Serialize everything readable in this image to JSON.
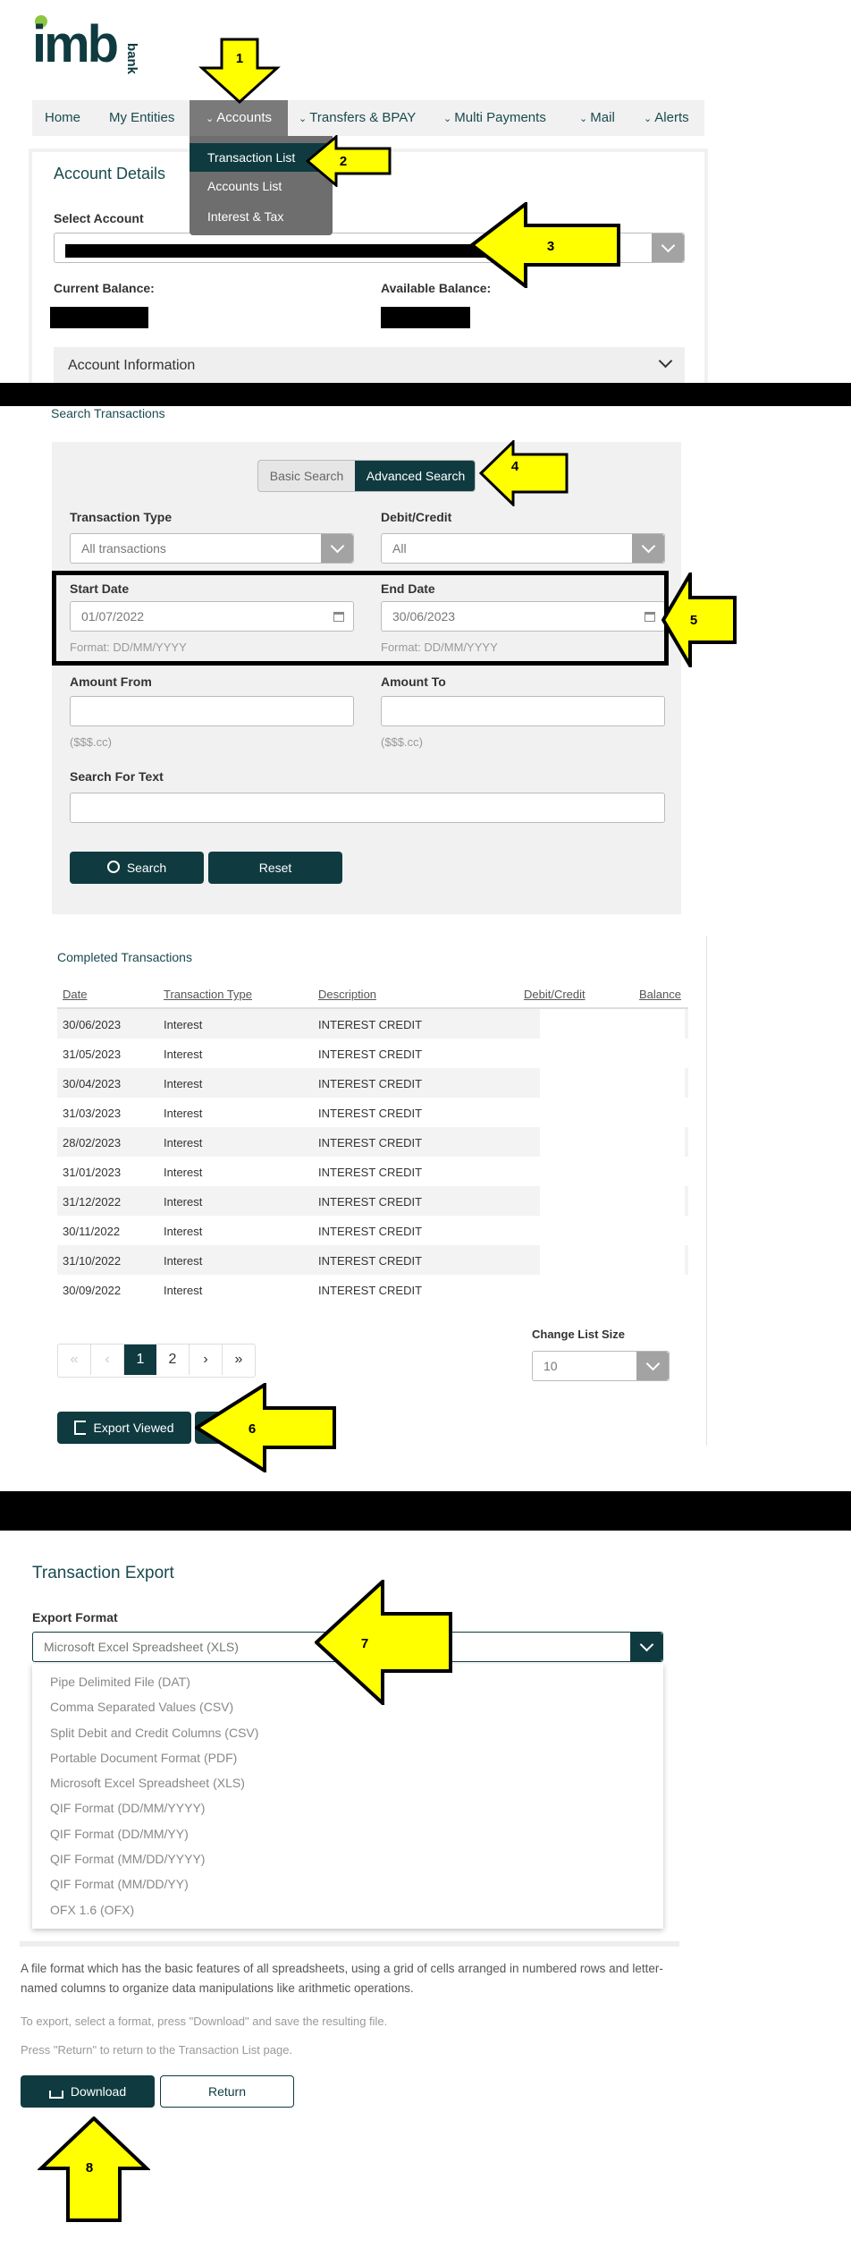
{
  "logo": {
    "main": "imb",
    "sub": "bank"
  },
  "nav": {
    "items": [
      {
        "label": "Home"
      },
      {
        "label": "My Entities"
      },
      {
        "label": "Accounts"
      },
      {
        "label": "Transfers & BPAY"
      },
      {
        "label": "Multi Payments"
      },
      {
        "label": "Mail"
      },
      {
        "label": "Alerts"
      }
    ],
    "dropdown": [
      "Transaction List",
      "Accounts List",
      "Interest & Tax"
    ]
  },
  "account_details": {
    "title": "Account Details",
    "select_label": "Select Account",
    "current_balance_label": "Current Balance:",
    "available_balance_label": "Available Balance:",
    "info_label": "Account Information"
  },
  "search": {
    "title": "Search Transactions",
    "basic_tab": "Basic Search",
    "advanced_tab": "Advanced Search",
    "tx_type_label": "Transaction Type",
    "tx_type_value": "All transactions",
    "debit_credit_label": "Debit/Credit",
    "debit_credit_value": "All",
    "start_date_label": "Start Date",
    "start_date_value": "01/07/2022",
    "end_date_label": "End Date",
    "end_date_value": "30/06/2023",
    "date_format": "Format: DD/MM/YYYY",
    "amount_from_label": "Amount From",
    "amount_to_label": "Amount To",
    "amount_hint": "($$$.cc)",
    "text_label": "Search For Text",
    "search_button": "Search",
    "reset_button": "Reset"
  },
  "completed": {
    "title": "Completed Transactions",
    "columns": [
      "Date",
      "Transaction Type",
      "Description",
      "Debit/Credit",
      "Balance"
    ],
    "rows": [
      {
        "date": "30/06/2023",
        "type": "Interest",
        "desc": "INTEREST CREDIT"
      },
      {
        "date": "31/05/2023",
        "type": "Interest",
        "desc": "INTEREST CREDIT"
      },
      {
        "date": "30/04/2023",
        "type": "Interest",
        "desc": "INTEREST CREDIT"
      },
      {
        "date": "31/03/2023",
        "type": "Interest",
        "desc": "INTEREST CREDIT"
      },
      {
        "date": "28/02/2023",
        "type": "Interest",
        "desc": "INTEREST CREDIT"
      },
      {
        "date": "31/01/2023",
        "type": "Interest",
        "desc": "INTEREST CREDIT"
      },
      {
        "date": "31/12/2022",
        "type": "Interest",
        "desc": "INTEREST CREDIT"
      },
      {
        "date": "30/11/2022",
        "type": "Interest",
        "desc": "INTEREST CREDIT"
      },
      {
        "date": "31/10/2022",
        "type": "Interest",
        "desc": "INTEREST CREDIT"
      },
      {
        "date": "30/09/2022",
        "type": "Interest",
        "desc": "INTEREST CREDIT"
      }
    ],
    "pagination": [
      "«",
      "‹",
      "1",
      "2",
      "›",
      "»"
    ],
    "list_size_label": "Change List Size",
    "list_size_value": "10",
    "export_button": "Export Viewed"
  },
  "export": {
    "title": "Transaction Export",
    "format_label": "Export Format",
    "format_value": "Microsoft Excel Spreadsheet (XLS)",
    "options": [
      "Pipe Delimited File (DAT)",
      "Comma Separated Values (CSV)",
      "Split Debit and Credit Columns (CSV)",
      "Portable Document Format (PDF)",
      "Microsoft Excel Spreadsheet (XLS)",
      "QIF Format (DD/MM/YYYY)",
      "QIF Format (DD/MM/YY)",
      "QIF Format (MM/DD/YYYY)",
      "QIF Format (MM/DD/YY)",
      "OFX 1.6 (OFX)"
    ],
    "description": "A file format which has the basic features of all spreadsheets, using a grid of cells arranged in numbered rows and letter-named columns to organize data manipulations like arithmetic operations.",
    "instruction": "To export, select a format, press \"Download\" and save the resulting file.",
    "return_note": "Press \"Return\" to return to the Transaction List page.",
    "download_button": "Download",
    "return_button": "Return"
  },
  "markers": [
    "1",
    "2",
    "3",
    "4",
    "5",
    "6",
    "7",
    "8"
  ],
  "colors": {
    "brand": "#0f3b40",
    "logo_green": "#8dc63f",
    "highlight": "#ffff00"
  }
}
